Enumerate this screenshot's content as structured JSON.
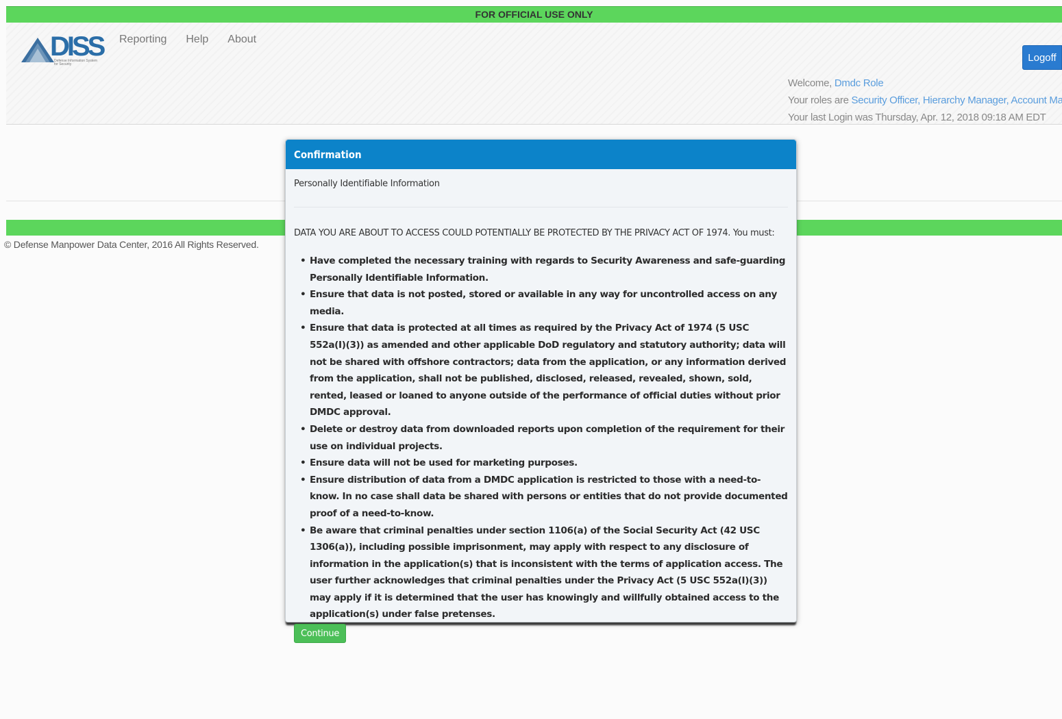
{
  "banner": {
    "text": "FOR OFFICIAL USE ONLY"
  },
  "logo": {
    "text": "DISS",
    "subtitle": "Defense Information System for Security"
  },
  "nav": {
    "items": [
      "Reporting",
      "Help",
      "About"
    ]
  },
  "header": {
    "logoff_label": "Logoff",
    "welcome_prefix": "Welcome, ",
    "user_name": "Dmdc Role",
    "roles_prefix": "Your roles are ",
    "roles": "Security Officer, Hierarchy Manager, Account Manager",
    "last_login": "Your last Login was Thursday, Apr. 12, 2018 09:18 AM EDT"
  },
  "footer": {
    "copyright": "© Defense Manpower Data Center, 2016 All Rights Reserved."
  },
  "modal": {
    "title": "Confirmation",
    "subtitle": "Personally Identifiable Information",
    "intro": "DATA YOU ARE ABOUT TO ACCESS COULD POTENTIALLY BE PROTECTED BY THE PRIVACY ACT OF 1974. You must:",
    "items": [
      "Have completed the necessary training with regards to Security Awareness and safe-guarding Personally Identifiable Information.",
      "Ensure that data is not posted, stored or available in any way for uncontrolled access on any media.",
      "Ensure that data is protected at all times as required by the Privacy Act of 1974 (5 USC 552a(I)(3)) as amended and other applicable DoD regulatory and statutory authority; data will not be shared with offshore contractors; data from the application, or any information derived from the application, shall not be published, disclosed, released, revealed, shown, sold, rented, leased or loaned to anyone outside of the performance of official duties without prior DMDC approval.",
      "Delete or destroy data from downloaded reports upon completion of the requirement for their use on individual projects.",
      "Ensure data will not be used for marketing purposes.",
      "Ensure distribution of data from a DMDC application is restricted to those with a need-to-know. In no case shall data be shared with persons or entities that do not provide documented proof of a need-to-know.",
      "Be aware that criminal penalties under section 1106(a) of the Social Security Act (42 USC 1306(a)), including possible imprisonment, may apply with respect to any disclosure of information in the application(s) that is inconsistent with the terms of application access. The user further acknowledges that criminal penalties under the Privacy Act (5 USC 552a(I)(3)) may apply if it is determined that the user has knowingly and willfully obtained access to the application(s) under false pretenses."
    ],
    "continue_label": "Continue"
  },
  "colors": {
    "banner_green": "#5cd65c",
    "modal_header_blue": "#0c83c9",
    "logoff_blue": "#2a7bd0",
    "continue_green": "#4cbf58",
    "link_blue": "#5a9ddd"
  }
}
